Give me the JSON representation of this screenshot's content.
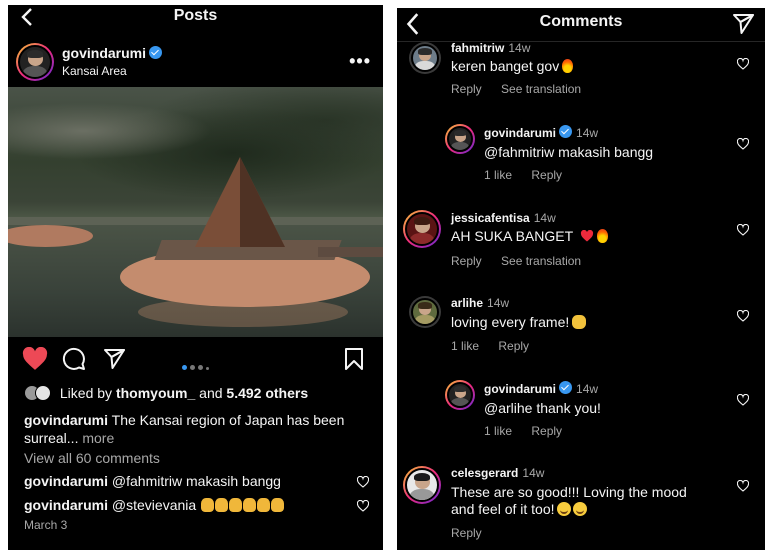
{
  "post_screen": {
    "title": "Posts",
    "author": {
      "username": "govindarumi",
      "location": "Kansai Area"
    },
    "liked_by": {
      "prefix": "Liked by",
      "user": "thomyoum_",
      "and": "and",
      "others": "5.492 others"
    },
    "caption": {
      "username": "govindarumi",
      "text": "The Kansai region of Japan has been surreal...",
      "more": "more"
    },
    "view_all": "View all 60 comments",
    "comments": [
      {
        "username": "govindarumi",
        "text": "@fahmitriw makasih bangg"
      },
      {
        "username": "govindarumi",
        "text": "@stevievania"
      }
    ],
    "date": "March 3",
    "carousel": {
      "current": 1,
      "total": 4
    }
  },
  "comments_screen": {
    "title": "Comments",
    "comments": [
      {
        "username": "fahmitriw",
        "time": "14w",
        "text": "keren banget gov",
        "reply": "Reply",
        "see_translation": "See translation"
      },
      {
        "username": "govindarumi",
        "time": "14w",
        "text": "@fahmitriw makasih bangg",
        "likes": "1 like",
        "reply": "Reply"
      },
      {
        "username": "jessicafentisa",
        "time": "14w",
        "text": "AH SUKA BANGET",
        "reply": "Reply",
        "see_translation": "See translation"
      },
      {
        "username": "arlihe",
        "time": "14w",
        "text": "loving every frame!",
        "likes": "1 like",
        "reply": "Reply"
      },
      {
        "username": "govindarumi",
        "time": "14w",
        "text": "@arlihe thank you!",
        "likes": "1 like",
        "reply": "Reply"
      },
      {
        "username": "celesgerard",
        "time": "14w",
        "text_line1": "These are so good!!! Loving the mood",
        "text_line2": "and feel of it too!",
        "reply": "Reply"
      }
    ]
  },
  "colors": {
    "background": "#000000",
    "text": "#f5f5f5",
    "muted": "#a8a8a8",
    "like_red": "#ed4956",
    "verified_blue": "#3897f0"
  },
  "icons": [
    "back-chevron-icon",
    "verified-icon",
    "more-icon",
    "heart-filled-icon",
    "comment-icon",
    "share-icon",
    "bookmark-icon",
    "heart-outline-icon",
    "send-icon"
  ]
}
